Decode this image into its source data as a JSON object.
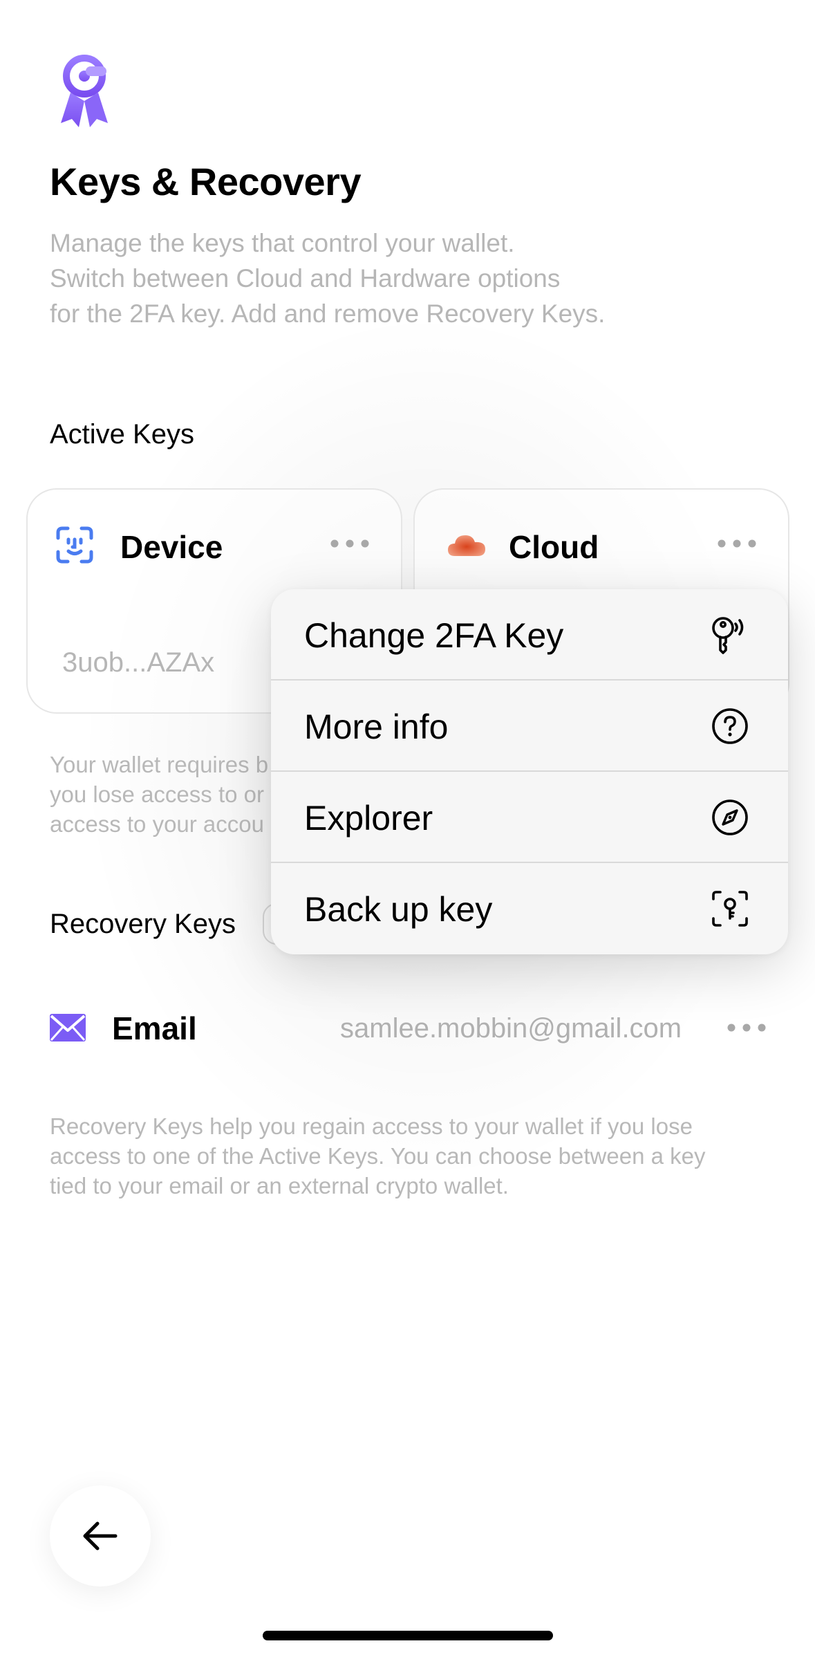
{
  "header": {
    "logo_icon": "key-badge-icon",
    "title": "Keys & Recovery",
    "description_lines": [
      "Manage the keys that control your wallet.",
      "Switch between Cloud and Hardware options",
      "for the 2FA key. Add and remove Recovery Keys."
    ]
  },
  "active_keys": {
    "section_title": "Active Keys",
    "cards": [
      {
        "icon": "face-id-icon",
        "title": "Device",
        "value": "3uob...AZAx",
        "more_icon": "more-dots-icon"
      },
      {
        "icon": "cloud-icon",
        "title": "Cloud",
        "more_icon": "more-dots-icon"
      }
    ],
    "note_lines": [
      "Your wallet requires b",
      "you lose access to or",
      "access to your accou"
    ]
  },
  "recovery_keys": {
    "section_title": "Recovery Keys",
    "items": [
      {
        "icon": "mail-icon",
        "label": "Email",
        "value": "samlee.mobbin@gmail.com",
        "more_icon": "more-dots-icon"
      }
    ],
    "note_lines": [
      "Recovery Keys help you regain access to your wallet if you lose",
      "access to one of the Active Keys. You can choose between a key",
      "tied to your email or an external crypto wallet."
    ]
  },
  "context_menu": {
    "items": [
      {
        "label": "Change 2FA Key",
        "icon": "key-signal-icon"
      },
      {
        "label": "More info",
        "icon": "question-circle-icon"
      },
      {
        "label": "Explorer",
        "icon": "compass-icon"
      },
      {
        "label": "Back up key",
        "icon": "key-scan-icon"
      }
    ]
  },
  "navigation": {
    "back_icon": "arrow-left-icon"
  },
  "colors": {
    "accent_purple": "#7b5cf5",
    "face_id_blue": "#4a7cf0",
    "cloud_orange": "#e8633a",
    "muted_text": "#b6b6b6",
    "menu_background": "#f6f6f6"
  }
}
